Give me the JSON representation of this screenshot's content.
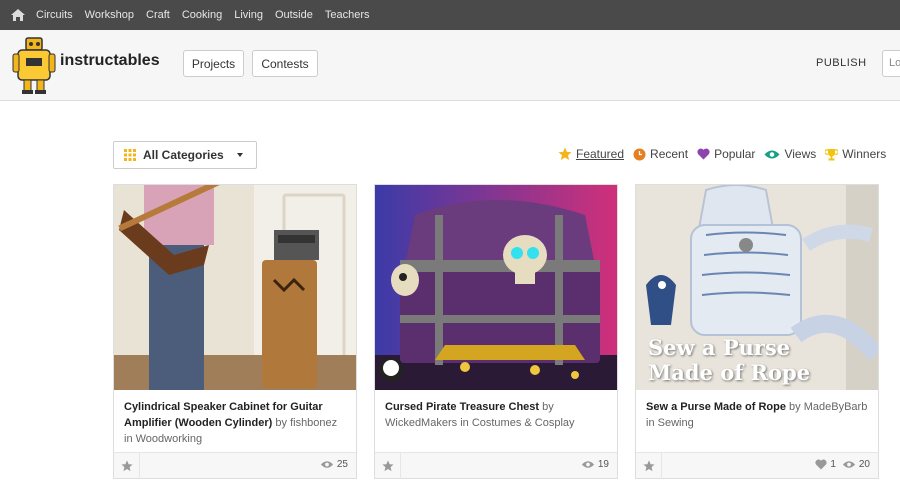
{
  "topnav": {
    "items": [
      "Circuits",
      "Workshop",
      "Craft",
      "Cooking",
      "Living",
      "Outside",
      "Teachers"
    ]
  },
  "header": {
    "brand": "instructables",
    "projects_label": "Projects",
    "contests_label": "Contests",
    "publish_label": "PUBLISH",
    "login_label": "Lo"
  },
  "filter": {
    "category_label": "All Categories",
    "sorts": [
      "Featured",
      "Recent",
      "Popular",
      "Views",
      "Winners"
    ],
    "active_sort": "Featured"
  },
  "cards": [
    {
      "title": "Cylindrical Speaker Cabinet for Guitar Amplifier (Wooden Cylinder)",
      "author": "fishbonez",
      "category": "Woodworking",
      "views": "25",
      "favorites": ""
    },
    {
      "title": "Cursed Pirate Treasure Chest",
      "author": "WickedMakers",
      "category": "Costumes & Cosplay",
      "views": "19",
      "favorites": ""
    },
    {
      "title": "Sew a Purse Made of Rope",
      "author": "MadeByBarb",
      "category": "Sewing",
      "views": "20",
      "favorites": "1",
      "image_text": [
        "Sew a Purse",
        "Made of Rope"
      ]
    }
  ],
  "labels": {
    "by": "by",
    "in": "in"
  },
  "colors": {
    "topbar": "#4a4a4a",
    "accent": "#fac934",
    "recent": "#e67e22",
    "popular": "#8e44ad",
    "views": "#16a085",
    "winners": "#f1c40f"
  }
}
